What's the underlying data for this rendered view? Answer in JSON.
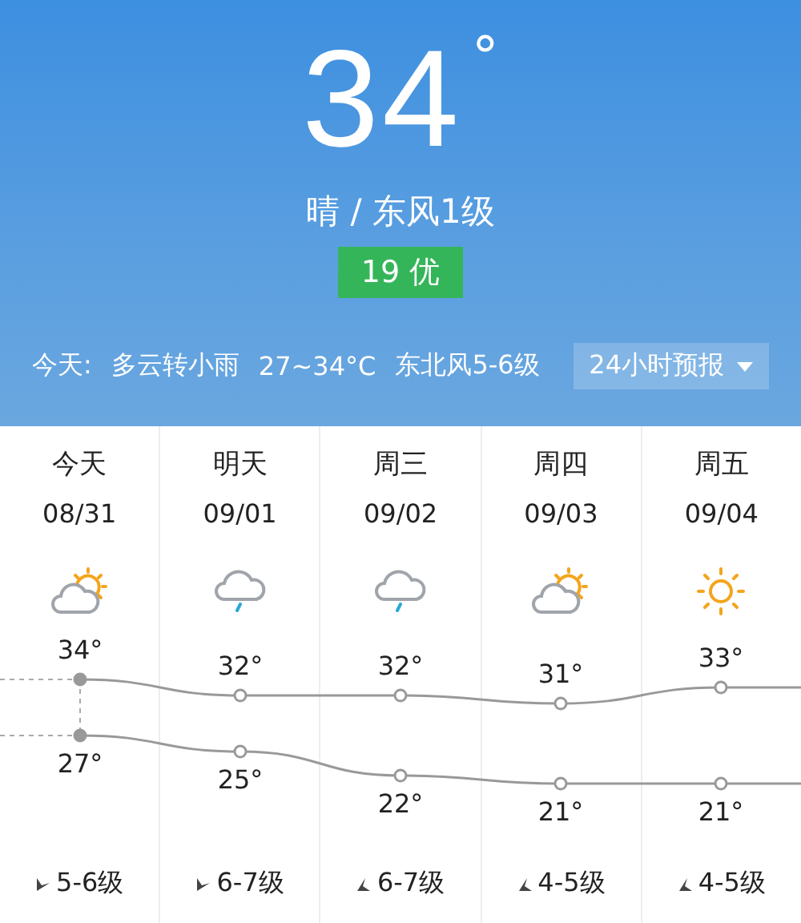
{
  "current": {
    "temperature": "34",
    "degree": "°",
    "condition": "晴 / 东风1级"
  },
  "aqi": {
    "text": "19 优",
    "color": "#35b55a"
  },
  "today_summary": {
    "label": "今天:",
    "weather": "多云转小雨",
    "range": "27~34°C",
    "wind": "东北风5-6级"
  },
  "hourly_button": {
    "label": "24小时预报"
  },
  "days": [
    {
      "name": "今天",
      "date": "08/31",
      "kind": "partly_cloudy",
      "high": "34°",
      "low": "27°",
      "wind": {
        "kind": "ne",
        "text": "5-6级"
      }
    },
    {
      "name": "明天",
      "date": "09/01",
      "kind": "light_rain",
      "high": "32°",
      "low": "25°",
      "wind": {
        "kind": "ne",
        "text": "6-7级"
      }
    },
    {
      "name": "周三",
      "date": "09/02",
      "kind": "light_rain",
      "high": "32°",
      "low": "22°",
      "wind": {
        "kind": "nw",
        "text": "6-7级"
      }
    },
    {
      "name": "周四",
      "date": "09/03",
      "kind": "partly_cloudy",
      "high": "31°",
      "low": "21°",
      "wind": {
        "kind": "nw",
        "text": "4-5级"
      }
    },
    {
      "name": "周五",
      "date": "09/04",
      "kind": "sunny",
      "high": "33°",
      "low": "21°",
      "wind": {
        "kind": "nw",
        "text": "4-5级"
      }
    }
  ]
}
